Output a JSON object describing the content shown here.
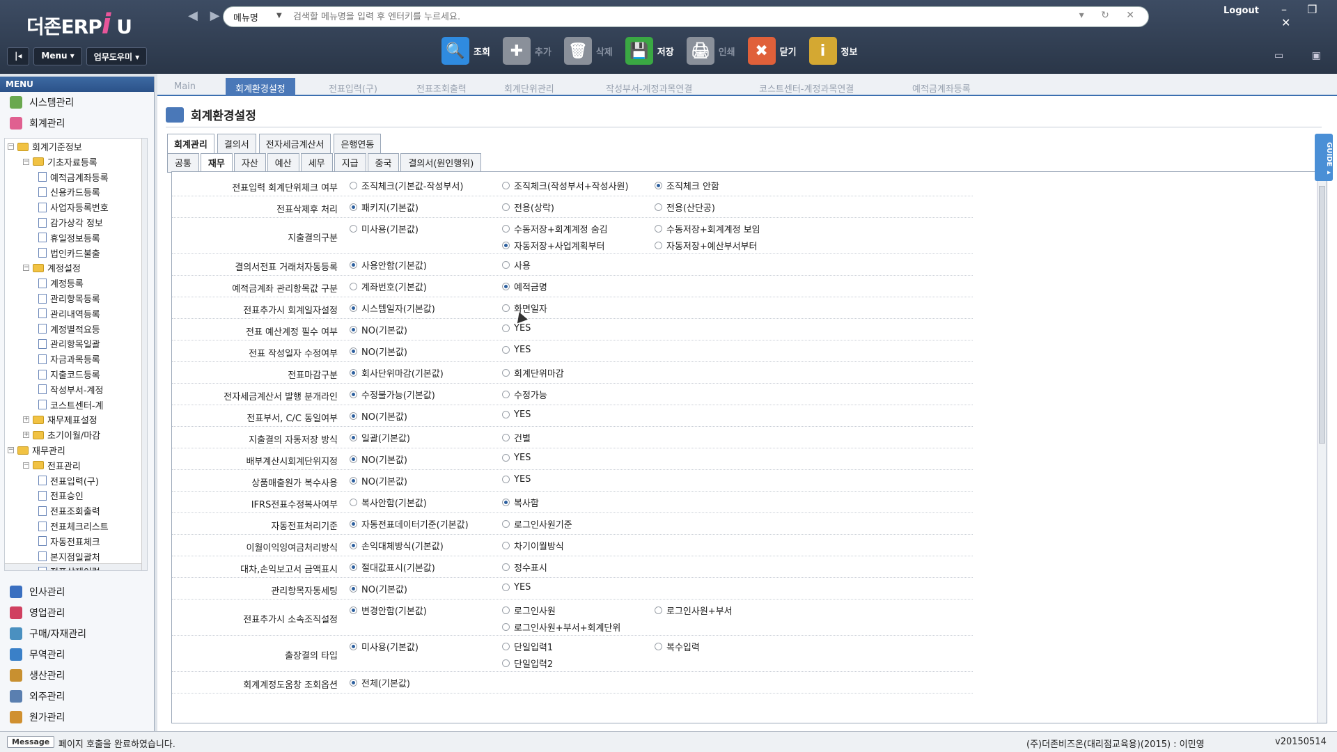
{
  "header": {
    "logo_text": "더존ERP",
    "logo_i": "i",
    "logo_u": "U",
    "nav": "◀ ▶",
    "search_combo": "메뉴명",
    "search_placeholder": "검색할 메뉴명을 입력 후 엔터키를 누르세요.",
    "search_tools": "▾ ↻ ✕",
    "logout": "Logout",
    "window_controls": "– ❐ ✕",
    "menu_btn": "Menu ▾",
    "help_btn": "업무도우미 ▾",
    "menu_toggle": "|◂",
    "topright_icons": "▭ ▣"
  },
  "toolbar": [
    {
      "label": "조회",
      "icon": "search-icon",
      "color": "#2f8be0",
      "glyph": "🔍",
      "enabled": true
    },
    {
      "label": "추가",
      "icon": "add-icon",
      "color": "#8a909a",
      "glyph": "✚",
      "enabled": false
    },
    {
      "label": "삭제",
      "icon": "trash-icon",
      "color": "#8a909a",
      "glyph": "🗑",
      "enabled": false
    },
    {
      "label": "저장",
      "icon": "save-icon",
      "color": "#3aa843",
      "glyph": "💾",
      "enabled": true
    },
    {
      "label": "인쇄",
      "icon": "print-icon",
      "color": "#8a909a",
      "glyph": "🖨",
      "enabled": false
    },
    {
      "label": "닫기",
      "icon": "close-icon",
      "color": "#e0603a",
      "glyph": "✖",
      "enabled": true
    },
    {
      "label": "정보",
      "icon": "info-icon",
      "color": "#d4a832",
      "glyph": "i",
      "enabled": true
    }
  ],
  "sidebar": {
    "header": "MENU",
    "top_items": [
      {
        "label": "시스템관리",
        "color": "#6aa84f"
      },
      {
        "label": "회계관리",
        "color": "#e06090"
      }
    ],
    "tree": [
      {
        "label": "회계기준정보",
        "level": 1,
        "type": "folder",
        "pm": "−"
      },
      {
        "label": "기초자료등록",
        "level": 2,
        "type": "folder",
        "pm": "−"
      },
      {
        "label": "예적금계좌등록",
        "level": 3,
        "type": "doc"
      },
      {
        "label": "신용카드등록",
        "level": 3,
        "type": "doc"
      },
      {
        "label": "사업자등록번호",
        "level": 3,
        "type": "doc"
      },
      {
        "label": "감가상각 정보",
        "level": 3,
        "type": "doc"
      },
      {
        "label": "휴일정보등록",
        "level": 3,
        "type": "doc"
      },
      {
        "label": "법인카드불출",
        "level": 3,
        "type": "doc"
      },
      {
        "label": "계정설정",
        "level": 2,
        "type": "folder",
        "pm": "−"
      },
      {
        "label": "계정등록",
        "level": 3,
        "type": "doc"
      },
      {
        "label": "관리항목등록",
        "level": 3,
        "type": "doc"
      },
      {
        "label": "관리내역등록",
        "level": 3,
        "type": "doc"
      },
      {
        "label": "계정별적요등",
        "level": 3,
        "type": "doc"
      },
      {
        "label": "관리항목일괄",
        "level": 3,
        "type": "doc"
      },
      {
        "label": "자금과목등록",
        "level": 3,
        "type": "doc"
      },
      {
        "label": "지출코드등록",
        "level": 3,
        "type": "doc"
      },
      {
        "label": "작성부서-계정",
        "level": 3,
        "type": "doc"
      },
      {
        "label": "코스트센터-계",
        "level": 3,
        "type": "doc"
      },
      {
        "label": "재무제표설정",
        "level": 2,
        "type": "folder",
        "pm": "+"
      },
      {
        "label": "초기이월/마감",
        "level": 2,
        "type": "folder",
        "pm": "+"
      },
      {
        "label": "재무관리",
        "level": 1,
        "type": "folder",
        "pm": "−"
      },
      {
        "label": "전표관리",
        "level": 2,
        "type": "folder",
        "pm": "−"
      },
      {
        "label": "전표입력(구)",
        "level": 3,
        "type": "doc"
      },
      {
        "label": "전표승인",
        "level": 3,
        "type": "doc"
      },
      {
        "label": "전표조회출력",
        "level": 3,
        "type": "doc"
      },
      {
        "label": "전표체크리스트",
        "level": 3,
        "type": "doc"
      },
      {
        "label": "자동전표체크",
        "level": 3,
        "type": "doc"
      },
      {
        "label": "본지점일괄처",
        "level": 3,
        "type": "doc"
      },
      {
        "label": "전표삭제이력",
        "level": 3,
        "type": "doc"
      }
    ],
    "modules": [
      {
        "label": "인사관리",
        "color": "#3a6fc0"
      },
      {
        "label": "영업관리",
        "color": "#d04060"
      },
      {
        "label": "구매/자재관리",
        "color": "#4a90c0"
      },
      {
        "label": "무역관리",
        "color": "#3a80c8"
      },
      {
        "label": "생산관리",
        "color": "#c89030"
      },
      {
        "label": "외주관리",
        "color": "#5a7fb0"
      },
      {
        "label": "원가관리",
        "color": "#d09030"
      }
    ]
  },
  "tabs": [
    {
      "label": "Main",
      "active": false
    },
    {
      "label": "회계환경설정",
      "active": true
    },
    {
      "label": "전표입력(구)",
      "active": false
    },
    {
      "label": "전표조회출력",
      "active": false
    },
    {
      "label": "회계단위관리",
      "active": false
    },
    {
      "label": "작성부서-계정과목연결",
      "active": false
    },
    {
      "label": "코스트센터-계정과목연결",
      "active": false
    },
    {
      "label": "예적금계좌등록",
      "active": false
    }
  ],
  "page_title": "회계환경설정",
  "subtabs": [
    {
      "label": "회계관리",
      "active": true
    },
    {
      "label": "결의서"
    },
    {
      "label": "전자세금계산서"
    },
    {
      "label": "은행연동"
    }
  ],
  "subtabs2": [
    {
      "label": "공통"
    },
    {
      "label": "재무",
      "active": true
    },
    {
      "label": "자산"
    },
    {
      "label": "예산"
    },
    {
      "label": "세무"
    },
    {
      "label": "지급"
    },
    {
      "label": "중국"
    },
    {
      "label": "결의서(원인행위)"
    }
  ],
  "settings": [
    {
      "label": "전표입력 회계단위체크 여부",
      "options": [
        {
          "t": "조직체크(기본값-작성부서)"
        },
        {
          "t": "조직체크(작성부서+작성사원)"
        },
        {
          "t": "조직체크 안함",
          "on": true
        }
      ]
    },
    {
      "label": "전표삭제후 처리",
      "options": [
        {
          "t": "패키지(기본값)",
          "on": true
        },
        {
          "t": "전용(상락)"
        },
        {
          "t": "전용(산단공)"
        }
      ]
    },
    {
      "label": "지출결의구분",
      "options": [
        {
          "t": "미사용(기본값)"
        },
        {
          "t": "수동저장+회계계정 숨김"
        },
        {
          "t": "수동저장+회계계정 보임"
        },
        {
          "t": "자동저장+사업계획부터",
          "on": true,
          "r": 2
        },
        {
          "t": "자동저장+예산부서부터",
          "r": 2
        }
      ],
      "tall": true
    },
    {
      "label": "결의서전표 거래처자동등록",
      "options": [
        {
          "t": "사용안함(기본값)",
          "on": true
        },
        {
          "t": "사용"
        }
      ]
    },
    {
      "label": "예적금계좌 관리항목값 구분",
      "options": [
        {
          "t": "계좌번호(기본값)"
        },
        {
          "t": "예적금명",
          "on": true
        }
      ]
    },
    {
      "label": "전표추가시 회계일자설정",
      "options": [
        {
          "t": "시스템일자(기본값)",
          "on": true
        },
        {
          "t": "화면일자"
        }
      ]
    },
    {
      "label": "전표 예산계정 필수 여부",
      "options": [
        {
          "t": "NO(기본값)",
          "on": true
        },
        {
          "t": "YES"
        }
      ]
    },
    {
      "label": "전표 작성일자 수정여부",
      "options": [
        {
          "t": "NO(기본값)",
          "on": true
        },
        {
          "t": "YES"
        }
      ]
    },
    {
      "label": "전표마감구분",
      "options": [
        {
          "t": "회사단위마감(기본값)",
          "on": true
        },
        {
          "t": "회계단위마감"
        }
      ]
    },
    {
      "label": "전자세금계산서 발행 분개라인",
      "options": [
        {
          "t": "수정불가능(기본값)",
          "on": true
        },
        {
          "t": "수정가능"
        }
      ]
    },
    {
      "label": "전표부서, C/C 동일여부",
      "options": [
        {
          "t": "NO(기본값)",
          "on": true
        },
        {
          "t": "YES"
        }
      ]
    },
    {
      "label": "지출결의 자동저장 방식",
      "options": [
        {
          "t": "일괄(기본값)",
          "on": true
        },
        {
          "t": "건별"
        }
      ]
    },
    {
      "label": "배부계산시회계단위지정",
      "options": [
        {
          "t": "NO(기본값)",
          "on": true
        },
        {
          "t": "YES"
        }
      ]
    },
    {
      "label": "상품매출원가 복수사용",
      "options": [
        {
          "t": "NO(기본값)",
          "on": true
        },
        {
          "t": "YES"
        }
      ]
    },
    {
      "label": "IFRS전표수정복사여부",
      "options": [
        {
          "t": "복사안함(기본값)"
        },
        {
          "t": "복사함",
          "on": true
        }
      ]
    },
    {
      "label": "자동전표처리기준",
      "options": [
        {
          "t": "자동전표데이터기준(기본값)",
          "on": true
        },
        {
          "t": "로그인사원기준"
        }
      ]
    },
    {
      "label": "이월이익잉여금처리방식",
      "options": [
        {
          "t": "손익대체방식(기본값)",
          "on": true
        },
        {
          "t": "차기이월방식"
        }
      ]
    },
    {
      "label": "대차,손익보고서 금액표시",
      "options": [
        {
          "t": "절대값표시(기본값)",
          "on": true
        },
        {
          "t": "정수표시"
        }
      ]
    },
    {
      "label": "관리항목자동세팅",
      "options": [
        {
          "t": "NO(기본값)",
          "on": true
        },
        {
          "t": "YES"
        }
      ]
    },
    {
      "label": "전표추가시 소속조직설정",
      "options": [
        {
          "t": "변경안함(기본값)",
          "on": true
        },
        {
          "t": "로그인사원"
        },
        {
          "t": "로그인사원+부서"
        },
        {
          "t": "로그인사원+부서+회계단위",
          "r": 2
        }
      ],
      "tall": true
    },
    {
      "label": "출장결의 타입",
      "options": [
        {
          "t": "미사용(기본값)",
          "on": true
        },
        {
          "t": "단일입력1"
        },
        {
          "t": "복수입력"
        },
        {
          "t": "단일입력2",
          "r": 2
        }
      ],
      "tall": true
    },
    {
      "label": "회계계정도움창 조회옵션",
      "options": [
        {
          "t": "전체(기본값)",
          "on": true
        }
      ]
    }
  ],
  "guide": "GUIDE ▸",
  "status": {
    "message_btn": "Message",
    "message": "페이지 호출을 완료하였습니다.",
    "company": "(주)더존비즈온(대리점교육용)(2015) : 이민영",
    "version": "v20150514"
  }
}
